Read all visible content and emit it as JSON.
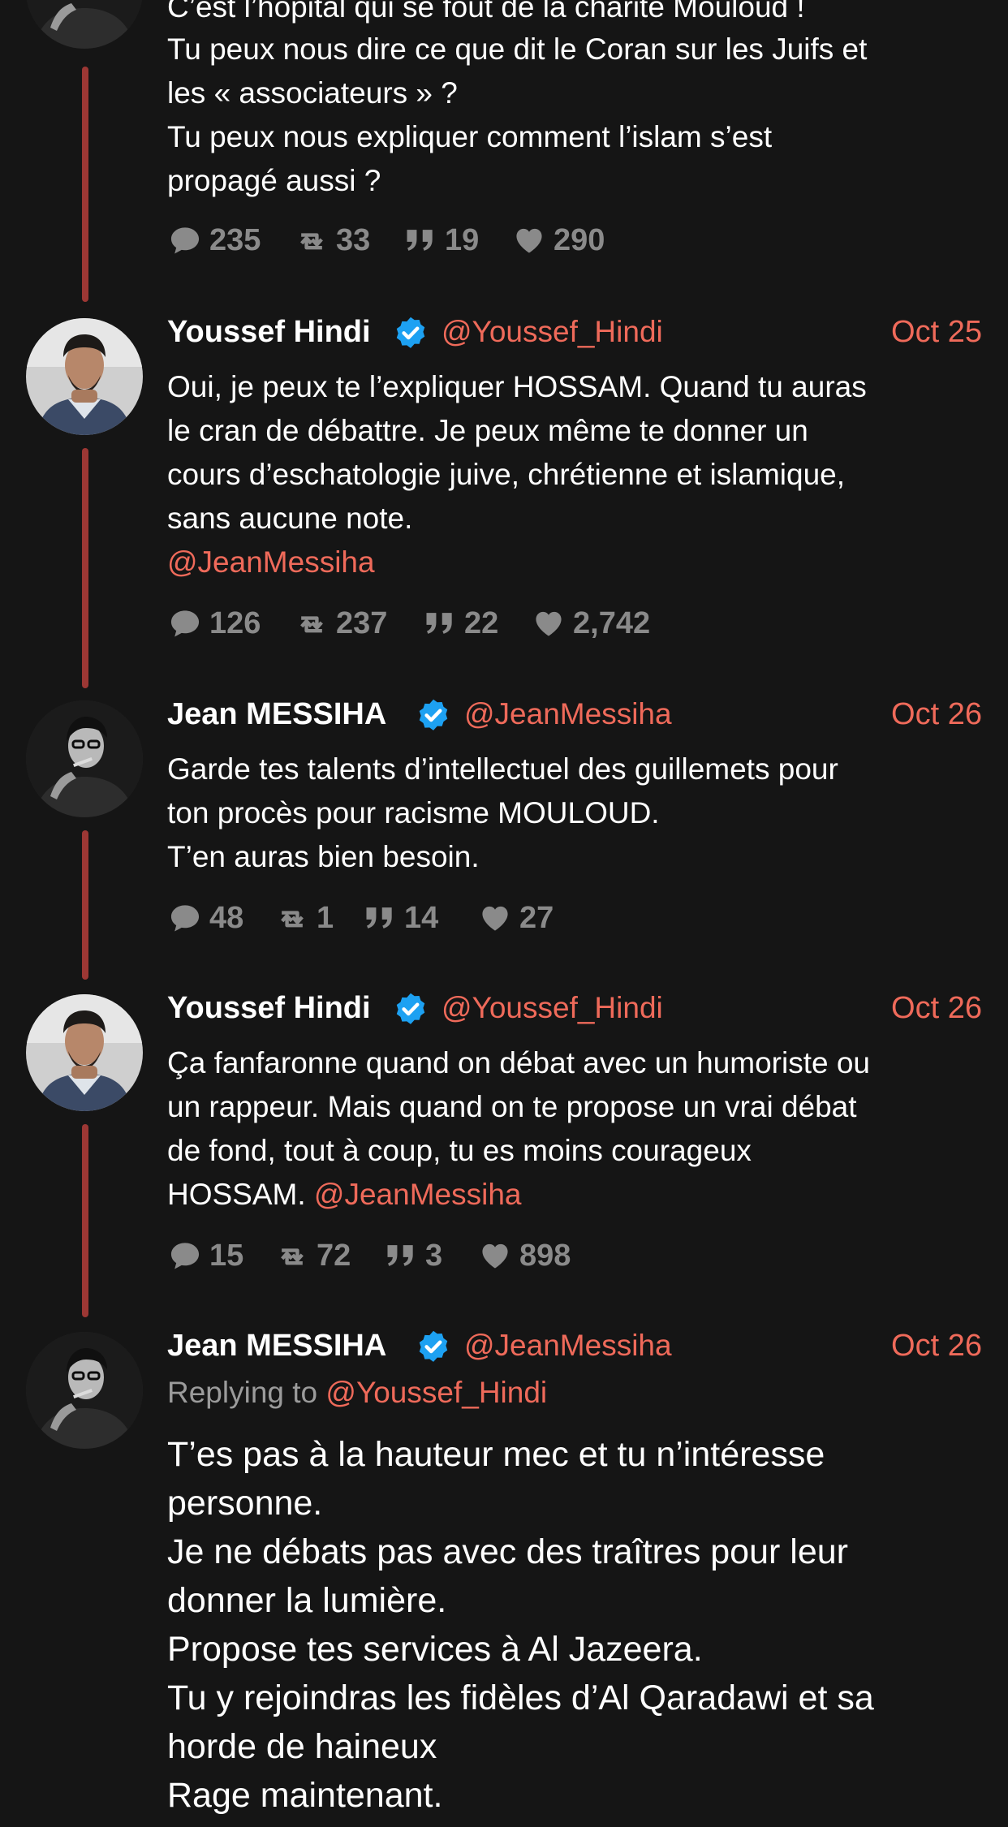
{
  "colors": {
    "background": "#151515",
    "accent": "#ef6a5a",
    "thread_line": "#9c3734",
    "verified": "#1da1f2",
    "muted": "#8a8a8a"
  },
  "tweets": [
    {
      "body_lines": [
        "C’est l’hôpital qui se fout de la charité Mouloud !",
        "Tu peux nous dire ce que dit le Coran sur les Juifs et",
        "les « associateurs » ?",
        "Tu peux nous expliquer comment l’islam s’est",
        "propagé aussi ?"
      ],
      "stats": {
        "replies": "235",
        "retweets": "33",
        "quotes": "19",
        "likes": "290"
      }
    },
    {
      "name": "Youssef Hindi",
      "handle": "@Youssef_Hindi",
      "date": "Oct 25",
      "avatar_icon": "person-avatar-icon",
      "body_lines": [
        "Oui, je peux te l’expliquer HOSSAM. Quand tu auras",
        "le cran de débattre. Je peux même te donner un",
        "cours d’eschatologie juive, chrétienne et islamique,",
        "sans aucune note."
      ],
      "mention": "@JeanMessiha",
      "stats": {
        "replies": "126",
        "retweets": "237",
        "quotes": "22",
        "likes": "2,742"
      }
    },
    {
      "name": "Jean MESSIHA",
      "handle": "@JeanMessiha",
      "date": "Oct 26",
      "avatar_icon": "person-avatar-icon",
      "body_lines": [
        "Garde tes talents d’intellectuel des guillemets pour",
        "ton procès pour racisme MOULOUD.",
        "T’en auras bien besoin."
      ],
      "stats": {
        "replies": "48",
        "retweets": "1",
        "quotes": "14",
        "likes": "27"
      }
    },
    {
      "name": "Youssef Hindi",
      "handle": "@Youssef_Hindi",
      "date": "Oct 26",
      "avatar_icon": "person-avatar-icon",
      "body_lines": [
        "Ça fanfaronne quand on débat avec un humoriste ou",
        "un rappeur. Mais quand on te propose un vrai débat",
        "de fond, tout à coup, tu es moins courageux",
        "HOSSAM."
      ],
      "mention": "@JeanMessiha",
      "stats": {
        "replies": "15",
        "retweets": "72",
        "quotes": "3",
        "likes": "898"
      }
    },
    {
      "name": "Jean MESSIHA",
      "handle": "@JeanMessiha",
      "date": "Oct 26",
      "avatar_icon": "person-avatar-icon",
      "replying_label": "Replying to",
      "replying_handle": "@Youssef_Hindi",
      "body_lines": [
        "T’es pas à la hauteur mec et tu n’intéresse",
        "personne.",
        "Je ne débats pas avec des traîtres pour leur",
        "donner la lumière.",
        "Propose tes services à Al Jazeera.",
        "Tu y rejoindras les fidèles d’Al Qaradawi et sa",
        "horde de haineux",
        "Rage maintenant."
      ]
    }
  ]
}
